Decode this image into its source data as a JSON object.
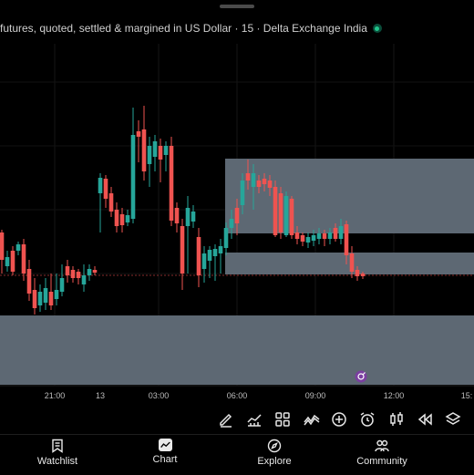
{
  "header": {
    "title": "futures, quoted, settled & margined in US Dollar · 15 · Delta Exchange India"
  },
  "time_axis": {
    "labels": [
      "21:00",
      "13",
      "03:00",
      "06:00",
      "09:00",
      "12:00",
      "15:"
    ]
  },
  "colors": {
    "up": "#26a69a",
    "down": "#ef5350",
    "zone": "#5d6873",
    "background": "#000000"
  },
  "toolbar": {
    "icons": [
      "pencil-icon",
      "trend-chart-icon",
      "grid-icon",
      "indicators-icon",
      "plus-circle-icon",
      "alarm-icon",
      "candles-icon",
      "rewind-icon",
      "layers-icon"
    ]
  },
  "nav": {
    "watchlist": "Watchlist",
    "chart": "Chart",
    "explore": "Explore",
    "community": "Community"
  }
}
